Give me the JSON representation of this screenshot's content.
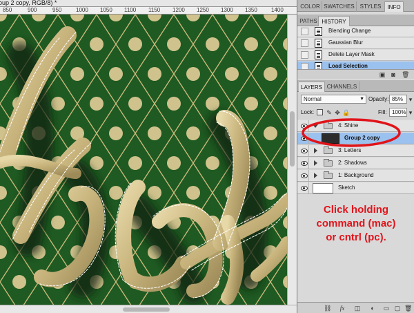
{
  "document": {
    "title": "oup 2 copy, RGB/8) *",
    "ruler_labels": [
      "850",
      "900",
      "950",
      "1000",
      "1050",
      "1100",
      "1150",
      "1200",
      "1250",
      "1300",
      "1350",
      "1400"
    ]
  },
  "panels": {
    "top_tabs": [
      "COLOR",
      "SWATCHES",
      "STYLES",
      "INFO"
    ],
    "active_top_tab": "INFO",
    "history_tabs": [
      "PATHS",
      "HISTORY"
    ],
    "history_items": [
      {
        "label": "Blending Change"
      },
      {
        "label": "Gaussian Blur"
      },
      {
        "label": "Delete Layer Mask"
      },
      {
        "label": "Load Selection",
        "selected": true
      }
    ],
    "layers_tabs": [
      "LAYERS",
      "CHANNELS"
    ],
    "blend_mode": "Normal",
    "opacity_label": "Opacity:",
    "opacity_value": "85%",
    "lock_label": "Lock:",
    "fill_label": "Fill:",
    "fill_value": "100%",
    "layers": [
      {
        "name": "4: Shine",
        "type": "group",
        "expanded": true
      },
      {
        "name": "Group 2 copy",
        "type": "layer",
        "selected": true
      },
      {
        "name": "3: Letters",
        "type": "group"
      },
      {
        "name": "2: Shadows",
        "type": "group"
      },
      {
        "name": "1: Background",
        "type": "group"
      },
      {
        "name": "Sketch",
        "type": "layer"
      }
    ],
    "footer_icons": [
      "link-icon",
      "fx-icon",
      "mask-icon",
      "adjustment-icon",
      "new-group-icon",
      "new-layer-icon",
      "trash-icon"
    ]
  },
  "annotation": {
    "line1": "Click holding",
    "line2": "command (mac)",
    "line3": "or cntrl (pc).",
    "color": "#e0141b"
  },
  "colors": {
    "canvas_green": "#1f5a22",
    "diamond_lines": "#c9b97a",
    "dots": "#cfc28c",
    "selection_blue": "#9bc1ee"
  }
}
